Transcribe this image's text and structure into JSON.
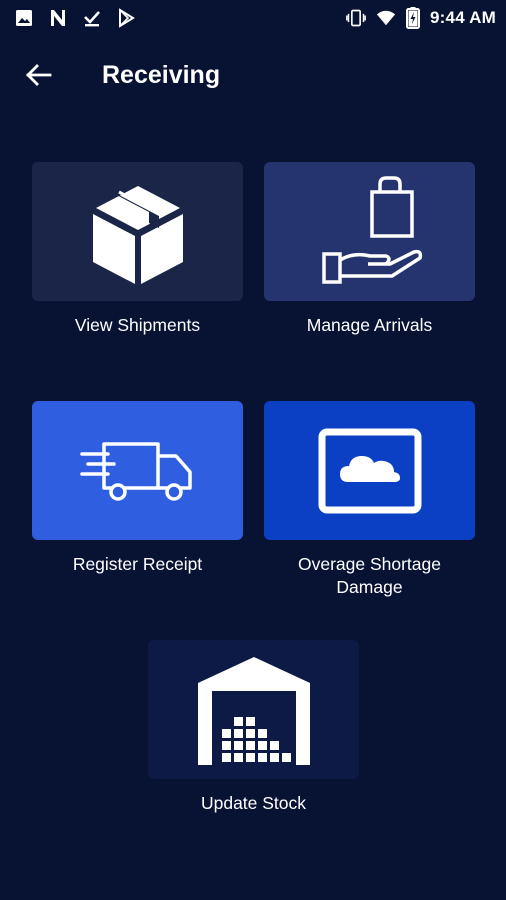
{
  "status_bar": {
    "time": "9:44 AM",
    "icons": [
      "image-icon",
      "n-icon",
      "download-done-icon",
      "play-store-icon",
      "vibrate-icon",
      "wifi-icon",
      "battery-charging-icon"
    ]
  },
  "app_bar": {
    "back_icon": "arrow-left-icon",
    "title": "Receiving"
  },
  "tiles": [
    {
      "label": "View Shipments",
      "icon": "box-icon",
      "color": "#1b2548"
    },
    {
      "label": "Manage Arrivals",
      "icon": "hand-bag-icon",
      "color": "#25336f"
    },
    {
      "label": "Register Receipt",
      "icon": "delivery-truck-icon",
      "color": "#2f5fe0"
    },
    {
      "label": "Overage Shortage Damage",
      "icon": "cloud-frame-icon",
      "color": "#0c40c4"
    },
    {
      "label": "Update Stock",
      "icon": "warehouse-icon",
      "color": "#0d1a45"
    }
  ],
  "colors": {
    "background": "#081233",
    "text": "#ffffff"
  }
}
